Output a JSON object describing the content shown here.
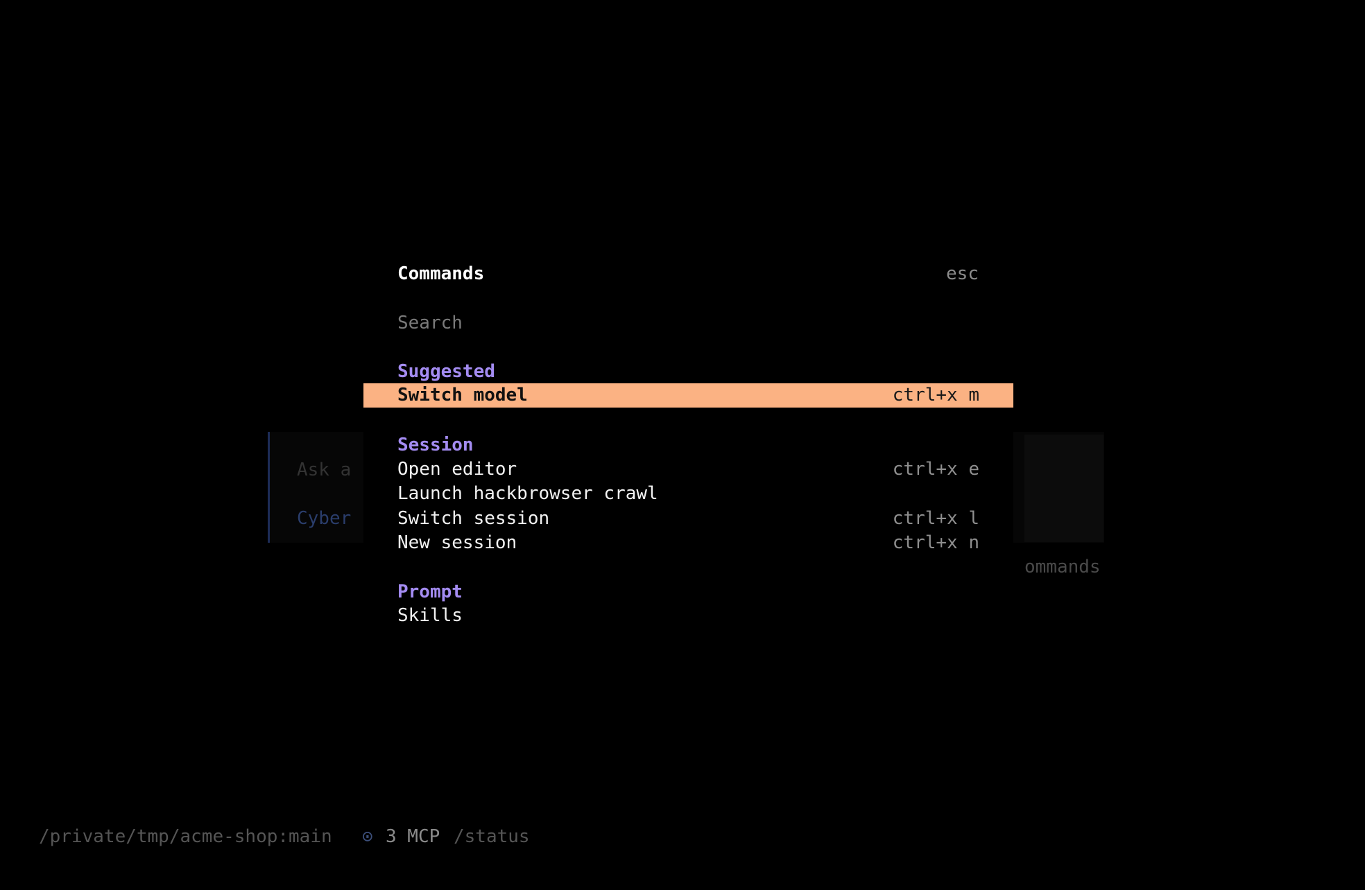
{
  "background": {
    "prompt_placeholder": "Ask a",
    "agent_label": "Cyber",
    "commands_hint": "ommands"
  },
  "dialog": {
    "title": "Commands",
    "close_hint": "esc",
    "search_placeholder": "Search",
    "search_value": "",
    "sections": {
      "suggested": {
        "label": "Suggested",
        "items": [
          {
            "label": "Switch model",
            "shortcut": "ctrl+x m"
          }
        ]
      },
      "session": {
        "label": "Session",
        "items": [
          {
            "label": "Open editor",
            "shortcut": "ctrl+x e"
          },
          {
            "label": "Launch hackbrowser crawl",
            "shortcut": ""
          },
          {
            "label": "Switch session",
            "shortcut": "ctrl+x l"
          },
          {
            "label": "New session",
            "shortcut": "ctrl+x n"
          }
        ]
      },
      "prompt": {
        "label": "Prompt",
        "items": [
          {
            "label": "Skills",
            "shortcut": ""
          }
        ]
      }
    }
  },
  "status_bar": {
    "path": "/private/tmp/acme-shop:main",
    "mcp_icon": "circle-dot-icon",
    "mcp_icon_glyph": "⊙",
    "mcp_count": "3 MCP",
    "status_command": "/status"
  },
  "colors": {
    "background": "#000000",
    "selected_row": "#fbb283",
    "section_heading": "#a48cf2",
    "muted_text": "#8a8a8a",
    "agent_accent": "#2a3d6b"
  }
}
